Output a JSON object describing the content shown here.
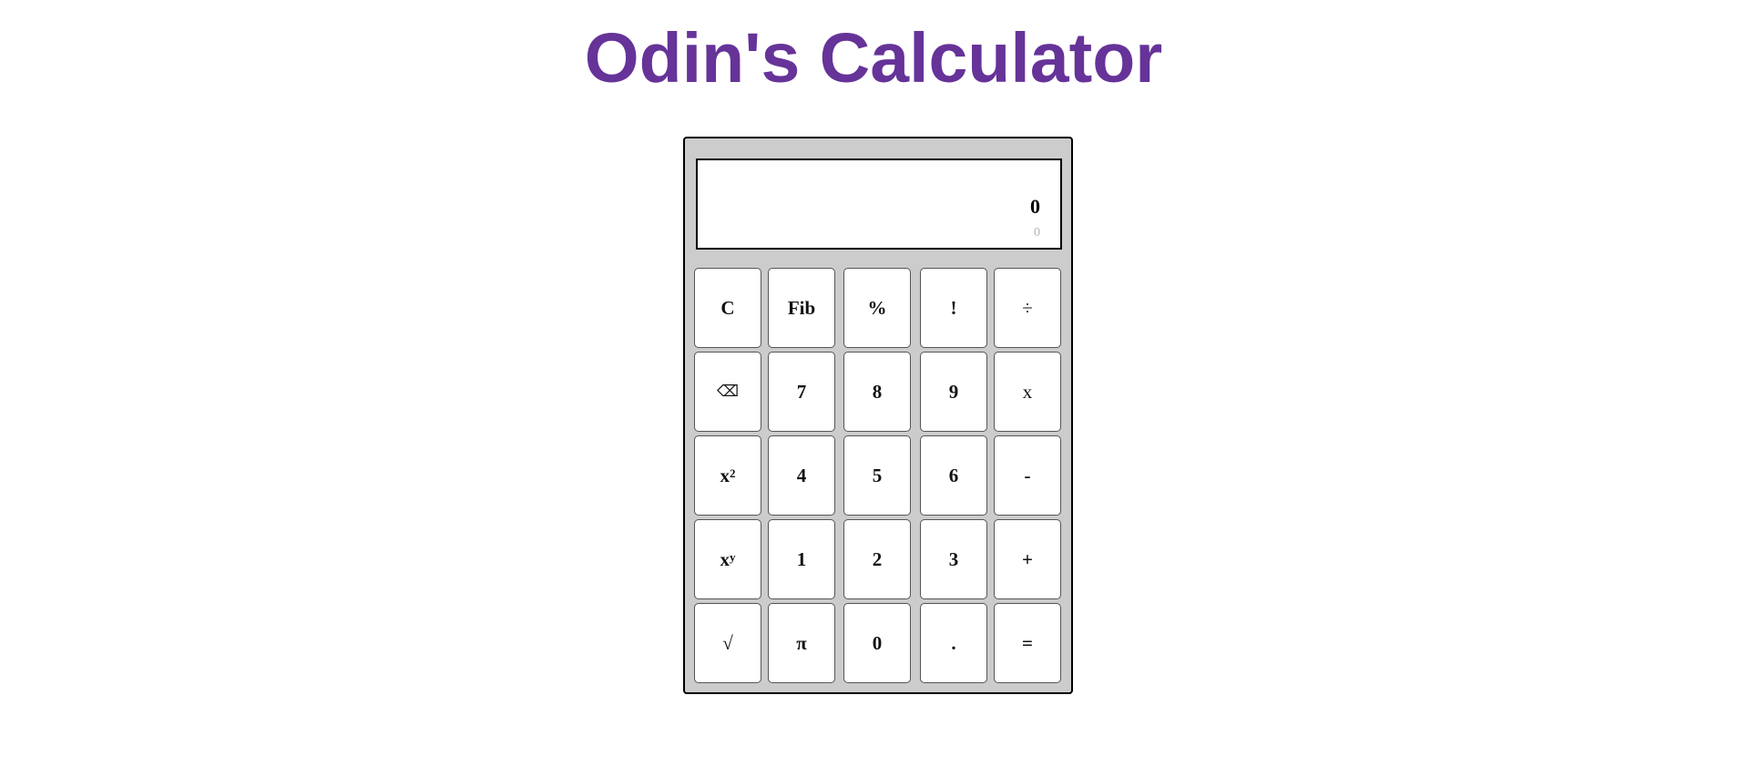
{
  "header": {
    "title": "Odin's Calculator"
  },
  "display": {
    "main_value": "0",
    "sub_value": "0"
  },
  "keys": {
    "clear": "C",
    "fib": "Fib",
    "percent": "%",
    "factorial": "!",
    "divide": "÷",
    "backspace": "⌫",
    "seven": "7",
    "eight": "8",
    "nine": "9",
    "multiply": "x",
    "square_base": "x",
    "square_exp": "2",
    "four": "4",
    "five": "5",
    "six": "6",
    "subtract": "-",
    "power_base": "x",
    "power_exp": "y",
    "one": "1",
    "two": "2",
    "three": "3",
    "add": "+",
    "sqrt": "√",
    "pi": "π",
    "zero": "0",
    "decimal": ".",
    "equals": "="
  },
  "colors": {
    "title": "#663399",
    "calculator_body": "#cccccc",
    "display_background": "#ffffff",
    "key_background": "#ffffff",
    "sub_display_text": "#b3b3b3"
  }
}
